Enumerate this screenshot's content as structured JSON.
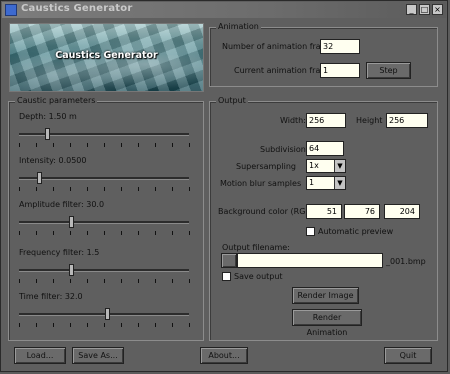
{
  "window": {
    "title": "Caustics Generator",
    "minimize": "_",
    "maximize": "□",
    "close": "×"
  },
  "banner": {
    "title": "Caustics Generator"
  },
  "animation": {
    "group_label": "Animation",
    "frames_label": "Number of animation frames:",
    "frames_value": "32",
    "current_label": "Current animation frame",
    "current_value": "1",
    "step_button": "Step"
  },
  "caustic": {
    "group_label": "Caustic parameters",
    "sliders": [
      {
        "label": "Depth:  1.50 m",
        "level": 0.16
      },
      {
        "label": "Intensity: 0.0500",
        "level": 0.11
      },
      {
        "label": "Amplitude filter:  30.0",
        "level": 0.3
      },
      {
        "label": "Frequency filter:  1.5",
        "level": 0.3
      },
      {
        "label": "Time filter:   32.0",
        "level": 0.52
      }
    ]
  },
  "output": {
    "group_label": "Output",
    "width_label": "Width:",
    "width_value": "256",
    "height_label": "Height",
    "height_value": "256",
    "subdivisions_label": "Subdivisions",
    "subdivisions_value": "64",
    "supersampling_label": "Supersampling",
    "supersampling_value": "1x",
    "motion_blur_label": "Motion blur samples",
    "motion_blur_value": "1",
    "bg_label": "Background color (RGB):",
    "bg_r": "51",
    "bg_g": "76",
    "bg_b": "204",
    "auto_preview_label": "Automatic preview",
    "filename_label": "Output filename:",
    "filename_value": "",
    "filename_suffix": "_001.bmp",
    "save_output_label": "Save output",
    "render_image_button": "Render Image",
    "render_animation_button": "Render Animation"
  },
  "footer": {
    "load": "Load...",
    "save_as": "Save As...",
    "about": "About...",
    "quit": "Quit"
  },
  "icons": {
    "app": "app-icon",
    "arrow": "chevron-down-icon",
    "cursor": "mouse-cursor-icon"
  }
}
